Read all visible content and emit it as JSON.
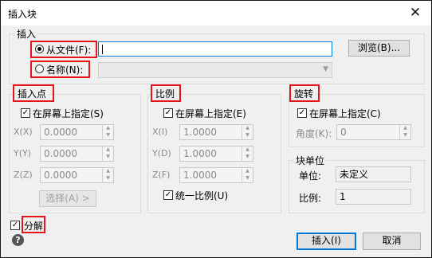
{
  "window": {
    "title": "插入块",
    "close_glyph": "✕"
  },
  "name_group": {
    "label": "插入",
    "from_file": {
      "label": "从文件(F):",
      "selected": true,
      "value": ""
    },
    "name": {
      "label": "名称(N):",
      "selected": false,
      "value": ""
    },
    "browse_label": "浏览(B)..."
  },
  "insert_point": {
    "label": "插入点",
    "specify_label": "在屏幕上指定(S)",
    "specify_checked": true,
    "x_label": "X(X)",
    "x_value": "0.0000",
    "y_label": "Y(Y)",
    "y_value": "0.0000",
    "z_label": "Z(Z)",
    "z_value": "0.0000",
    "select_label": "选择(A) >"
  },
  "scale": {
    "label": "比例",
    "specify_label": "在屏幕上指定(E)",
    "specify_checked": true,
    "x_label": "X(I)",
    "x_value": "1.0000",
    "y_label": "Y(D)",
    "y_value": "1.0000",
    "z_label": "Z(F)",
    "z_value": "1.0000",
    "uniform_label": "统一比例(U)",
    "uniform_checked": true
  },
  "rotation": {
    "label": "旋转",
    "specify_label": "在屏幕上指定(C)",
    "specify_checked": true,
    "angle_label": "角度(K):",
    "angle_value": "0"
  },
  "block_unit": {
    "label": "块单位",
    "unit_label": "单位:",
    "unit_value": "未定义",
    "factor_label": "比例:",
    "factor_value": "1"
  },
  "explode": {
    "label": "分解",
    "checked": true
  },
  "buttons": {
    "insert": "插入(I)",
    "cancel": "取消"
  },
  "help_glyph": "?",
  "colors": {
    "highlight_box": "#e8141b",
    "focus_border": "#0078d7",
    "dialog_bg": "#f0f0f0"
  }
}
